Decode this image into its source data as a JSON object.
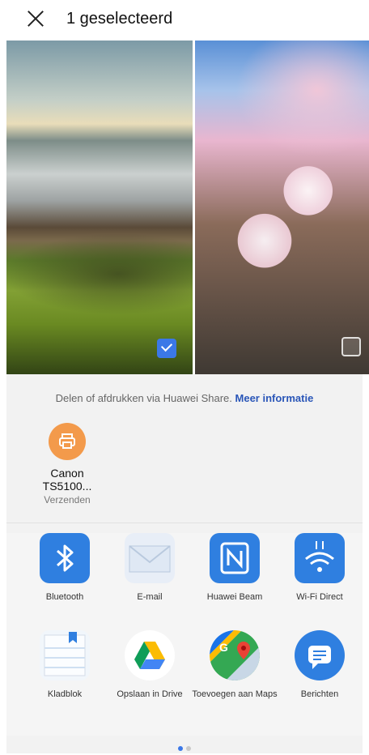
{
  "header": {
    "title": "1 geselecteerd"
  },
  "photos": [
    {
      "name": "landscape-photo",
      "selected": true
    },
    {
      "name": "blossom-photo",
      "selected": false
    }
  ],
  "share": {
    "info_text": "Delen of afdrukken via Huawei Share.",
    "info_link": "Meer informatie",
    "printer": {
      "name_line1": "Canon",
      "name_line2": "TS5100...",
      "status": "Verzenden",
      "icon": "printer-icon",
      "color": "#f39a4b"
    }
  },
  "apps": [
    {
      "label": "Bluetooth",
      "icon": "bluetooth-icon"
    },
    {
      "label": "E-mail",
      "icon": "email-icon"
    },
    {
      "label": "Huawei Beam",
      "icon": "nfc-icon"
    },
    {
      "label": "Wi-Fi Direct",
      "icon": "wifi-direct-icon"
    },
    {
      "label": "Kladblok",
      "icon": "notepad-icon"
    },
    {
      "label": "Opslaan in Drive",
      "icon": "google-drive-icon"
    },
    {
      "label": "Toevoegen aan Maps",
      "icon": "google-maps-icon"
    },
    {
      "label": "Berichten",
      "icon": "messages-icon"
    }
  ],
  "pager": {
    "pages": 2,
    "current": 1
  },
  "colors": {
    "accent": "#3b78e7",
    "link": "#2a56b8",
    "sheet_bg": "#f2f2f2"
  }
}
